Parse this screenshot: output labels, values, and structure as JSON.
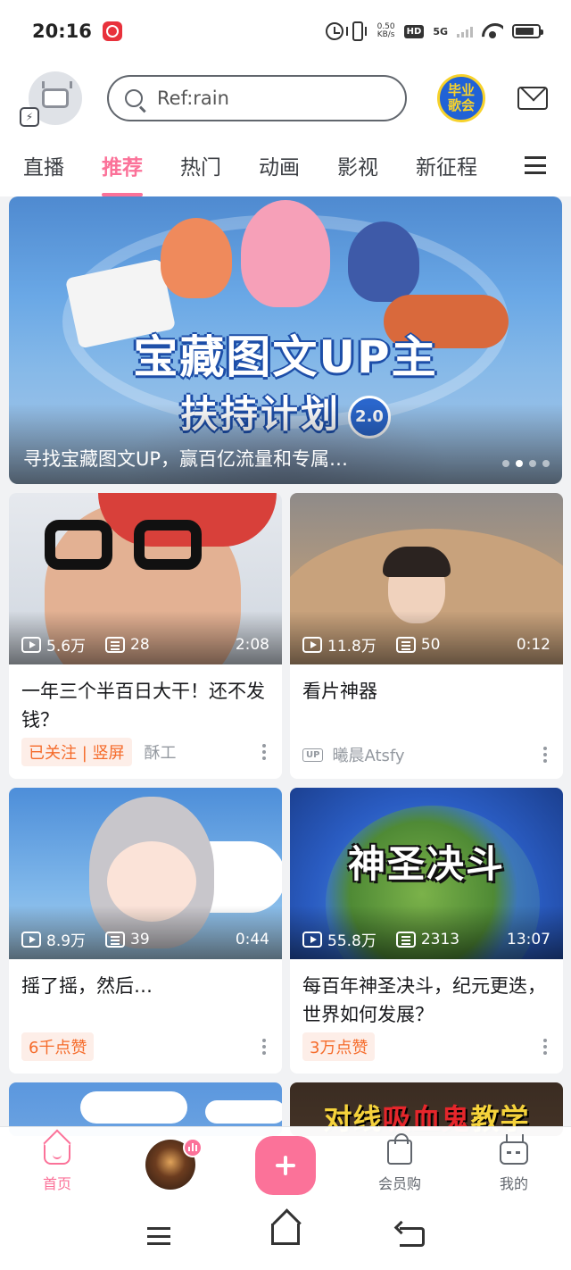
{
  "status_bar": {
    "time": "20:16",
    "net_speed_value": "0.50",
    "net_speed_unit": "KB/s",
    "hd_label": "HD",
    "network_label": "5G",
    "battery_level": 0.85
  },
  "header": {
    "search_placeholder": "Ref:rain",
    "promo_badge": "毕业\n歌会"
  },
  "tabs": [
    {
      "label": "直播",
      "active": false
    },
    {
      "label": "推荐",
      "active": true
    },
    {
      "label": "热门",
      "active": false
    },
    {
      "label": "动画",
      "active": false
    },
    {
      "label": "影视",
      "active": false
    },
    {
      "label": "新征程",
      "active": false
    }
  ],
  "banner": {
    "title_line1": "宝藏图文UP主",
    "title_line2": "扶持计划",
    "version": "2.0",
    "caption": "寻找宝藏图文UP，赢百亿流量和专属…",
    "dots_total": 4,
    "dots_active": 1
  },
  "feed": [
    {
      "views": "5.6万",
      "danmaku": "28",
      "duration": "2:08",
      "title": "一年三个半百日大干！还不发钱？",
      "tag": "已关注 | 竖屏",
      "author": "酥工"
    },
    {
      "views": "11.8万",
      "danmaku": "50",
      "duration": "0:12",
      "title": "看片神器",
      "up_label": "UP",
      "author": "曦晨Atsfy"
    },
    {
      "views": "8.9万",
      "danmaku": "39",
      "duration": "0:44",
      "title": "摇了摇，然后…",
      "tag": "6千点赞"
    },
    {
      "views": "55.8万",
      "danmaku": "2313",
      "duration": "13:07",
      "title": "每百年神圣决斗，纪元更迭，世界如何发展？",
      "tag": "3万点赞",
      "thumb_text": "神圣决斗"
    },
    {
      "thumb_text": ""
    },
    {
      "thumb_text_a": "对线",
      "thumb_text_b": "吸血鬼",
      "thumb_text_c": "教学"
    }
  ],
  "bottom_nav": {
    "home": "首页",
    "shop": "会员购",
    "me": "我的"
  },
  "colors": {
    "accent": "#fb7299",
    "tag_text": "#f56b2a",
    "tag_bg": "#fdeee8"
  }
}
